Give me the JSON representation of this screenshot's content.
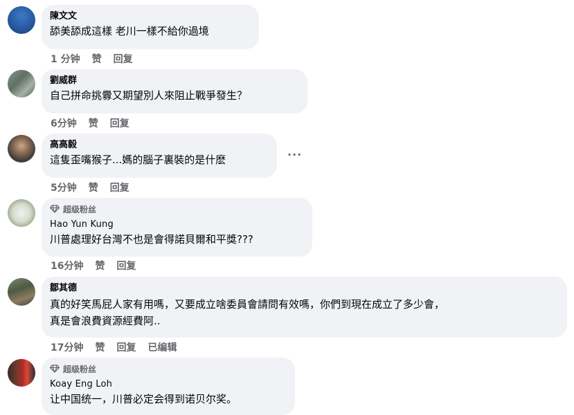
{
  "comments": [
    {
      "author": "陳文文",
      "text": "舔美舔成這樣 老川一樣不給你過境",
      "time": "1 分钟",
      "like": "赞",
      "reply": "回复"
    },
    {
      "author": "劉威群",
      "text": "自己拼命挑釁又期望別人來阻止戰爭發生？",
      "time": "6分钟",
      "like": "赞",
      "reply": "回复"
    },
    {
      "author": "高高毅",
      "text": "這隻歪嘴猴子...媽的腦子裏裝的是什麽",
      "time": "5分钟",
      "like": "赞",
      "reply": "回复",
      "more": "···"
    },
    {
      "badge": "超级粉丝",
      "author": "Hao Yun Kung",
      "text": "川普處理好台灣不也是會得諾貝爾和平獎???",
      "time": "16分钟",
      "like": "赞",
      "reply": "回复"
    },
    {
      "author": "鄒其德",
      "text": "真的好笑馬屁人家有用嗎，又要成立啥委員會請問有效嗎，你們到現在成立了多少會，\n真是會浪費資源經費阿..",
      "time": "17分钟",
      "like": "赞",
      "reply": "回复",
      "edited": "已编辑"
    },
    {
      "badge": "超级粉丝",
      "author": "Koay Eng Loh",
      "text": "让中国统一，川普必定会得到诺贝尔奖。"
    }
  ]
}
